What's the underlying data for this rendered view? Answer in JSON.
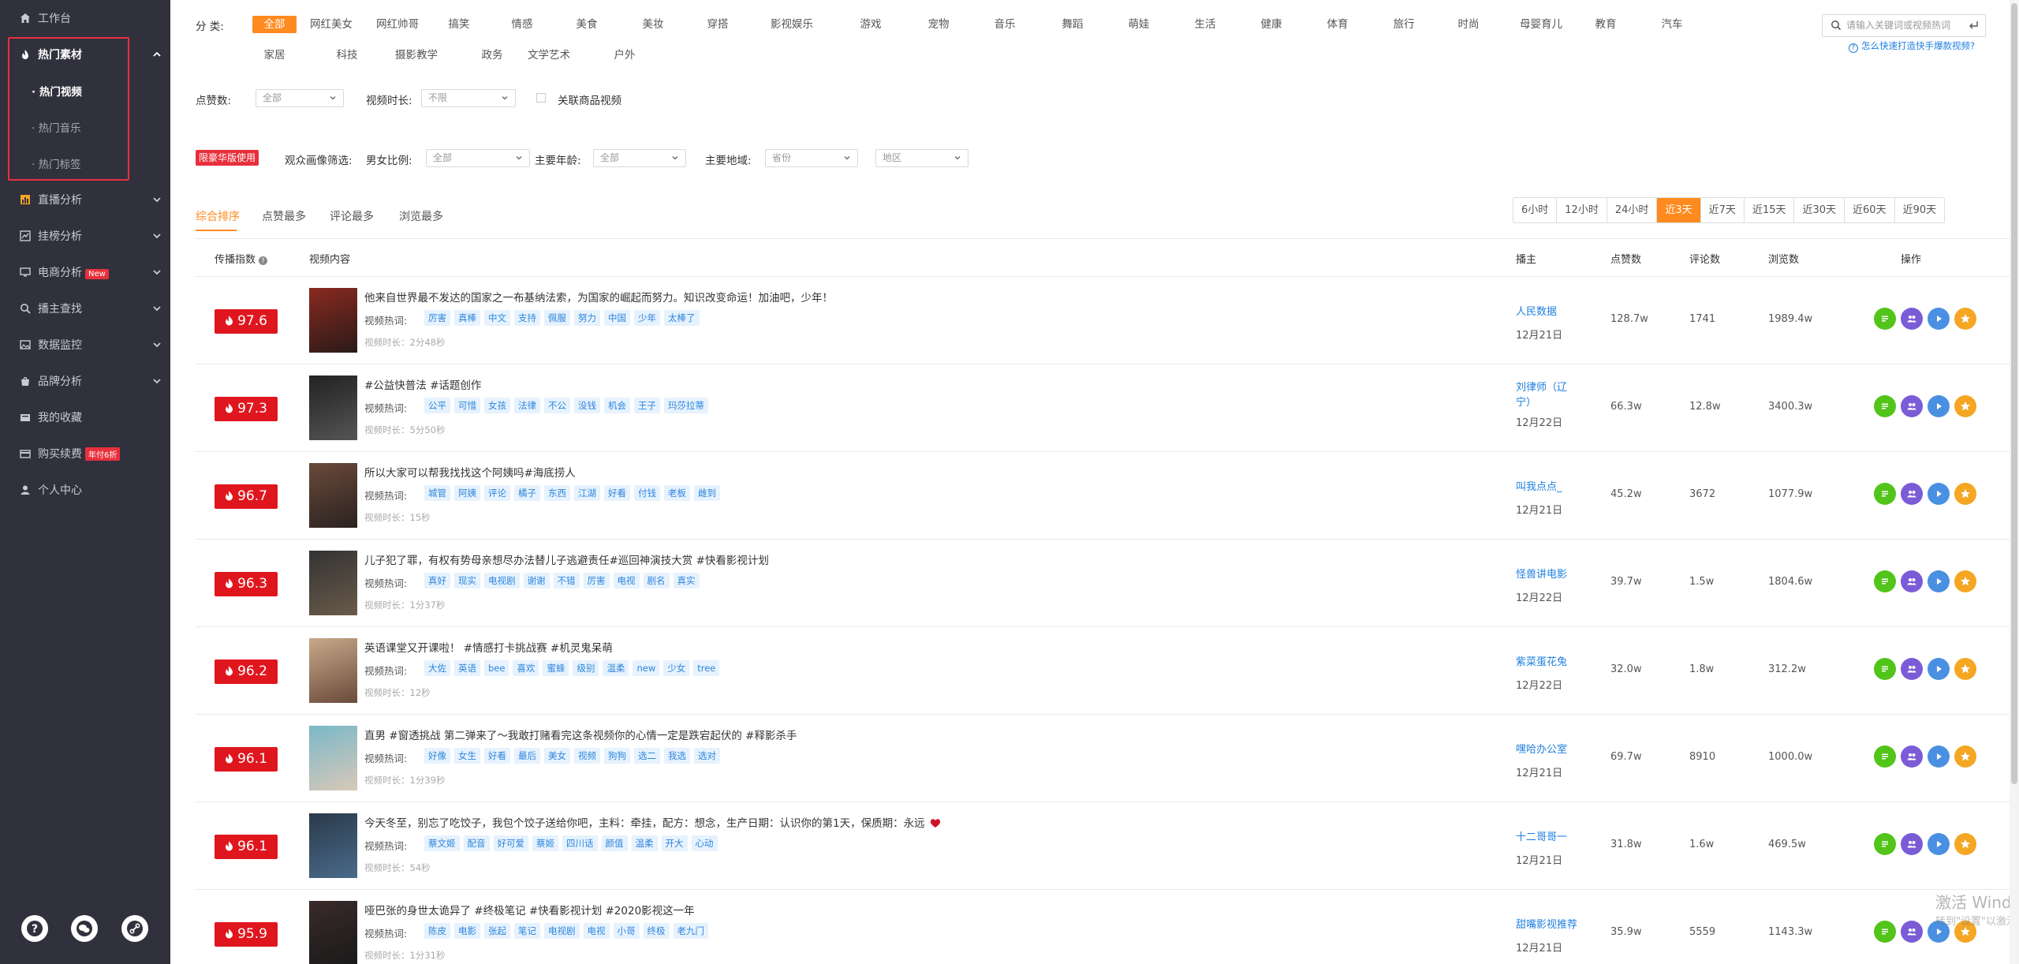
{
  "colors": {
    "accent": "#ff8a1f",
    "score_red": "#e0161e",
    "link_blue": "#1e7fe0",
    "sidebar_bg": "#30313d",
    "op_green": "#52c41a",
    "op_purple": "#7b5cd6",
    "op_blue": "#4a90e2",
    "op_orange": "#f5a623"
  },
  "sidebar": {
    "workbench": "工作台",
    "hot_material": "热门素材",
    "sub": [
      "· 热门视频",
      "· 热门音乐",
      "· 热门标签"
    ],
    "items": [
      "直播分析",
      "挂榜分析",
      "电商分析",
      "播主查找",
      "数据监控",
      "品牌分析",
      "我的收藏",
      "购买续费",
      "个人中心"
    ],
    "badge_new": "New",
    "badge_discount": "年付6折"
  },
  "filters": {
    "category_label": "分  类:",
    "categories_row1": [
      "全部",
      "网红美女",
      "网红帅哥",
      "搞笑",
      "情感",
      "美食",
      "美妆",
      "穿搭",
      "影视娱乐",
      "游戏",
      "宠物",
      "音乐",
      "舞蹈",
      "萌娃",
      "生活",
      "健康",
      "体育",
      "旅行",
      "时尚",
      "母婴育儿",
      "教育",
      "汽车"
    ],
    "categories_row2": [
      "家居",
      "科技",
      "摄影教学",
      "政务",
      "文学艺术",
      "户外"
    ],
    "likes_label": "点赞数:",
    "likes_value": "全部",
    "duration_label": "视频时长:",
    "duration_value": "不限",
    "goods_label": "关联商品视频",
    "premium_tag": "限豪华版使用",
    "audience_label": "观众画像筛选:",
    "gender_label": "男女比例:",
    "gender_value": "全部",
    "age_label": "主要年龄:",
    "age_value": "全部",
    "region_label": "主要地域:",
    "province_value": "省份",
    "city_value": "地区",
    "search_placeholder": "请输入关键词或视频热词",
    "help_link": "怎么快速打造快手爆款视频?"
  },
  "sort_tabs": [
    "综合排序",
    "点赞最多",
    "评论最多",
    "浏览最多"
  ],
  "time_tabs": [
    "6小时",
    "12小时",
    "24小时",
    "近3天",
    "近7天",
    "近15天",
    "近30天",
    "近60天",
    "近90天"
  ],
  "table": {
    "headers": {
      "index": "传播指数",
      "content": "视频内容",
      "author": "播主",
      "likes": "点赞数",
      "comments": "评论数",
      "views": "浏览数",
      "ops": "操作"
    },
    "kw_label": "视频热词:",
    "rows": [
      {
        "score": "97.6",
        "title": "他来自世界最不发达的国家之一布基纳法索，为国家的崛起而努力。知识改变命运！加油吧，少年！",
        "kw": [
          "厉害",
          "真棒",
          "中文",
          "支持",
          "佩服",
          "努力",
          "中国",
          "少年",
          "太棒了"
        ],
        "dur": "视频时长：2分48秒",
        "author": "人民数据",
        "date": "12月21日",
        "likes": "128.7w",
        "comments": "1741",
        "views": "1989.4w"
      },
      {
        "score": "97.3",
        "title": "#公益快普法 #话题创作",
        "kw": [
          "公平",
          "可惜",
          "女孩",
          "法律",
          "不公",
          "没钱",
          "机会",
          "王子",
          "玛莎拉蒂"
        ],
        "dur": "视频时长：5分50秒",
        "author": "刘律师（辽宁）",
        "date": "12月22日",
        "likes": "66.3w",
        "comments": "12.8w",
        "views": "3400.3w"
      },
      {
        "score": "96.7",
        "title": "所以大家可以帮我找找这个阿姨吗#海底捞人",
        "kw": [
          "城管",
          "阿姨",
          "评论",
          "橘子",
          "东西",
          "江湖",
          "好看",
          "付钱",
          "老板",
          "雌到"
        ],
        "dur": "视频时长：15秒",
        "author": "叫我点点_",
        "date": "12月21日",
        "likes": "45.2w",
        "comments": "3672",
        "views": "1077.9w"
      },
      {
        "score": "96.3",
        "title": "儿子犯了罪，有权有势母亲想尽办法替儿子逃避责任#巡回神演技大赏 #快看影视计划",
        "kw": [
          "真好",
          "现实",
          "电视剧",
          "谢谢",
          "不错",
          "厉害",
          "电视",
          "剧名",
          "真实"
        ],
        "dur": "视频时长：1分37秒",
        "author": "怪兽讲电影",
        "date": "12月22日",
        "likes": "39.7w",
        "comments": "1.5w",
        "views": "1804.6w"
      },
      {
        "score": "96.2",
        "title": "英语课堂又开课啦！ #情感打卡挑战赛 #机灵鬼呆萌",
        "kw": [
          "大佐",
          "英语",
          "bee",
          "喜欢",
          "蜜蜂",
          "级别",
          "温柔",
          "new",
          "少女",
          "tree"
        ],
        "dur": "视频时长：12秒",
        "author": "紫菜蛋花兔",
        "date": "12月22日",
        "likes": "32.0w",
        "comments": "1.8w",
        "views": "312.2w"
      },
      {
        "score": "96.1",
        "title": "直男 #窗透挑战 第二弹来了～我敢打赌看完这条视频你的心情一定是跌宕起伏的 #释影杀手",
        "kw": [
          "好像",
          "女生",
          "好看",
          "最后",
          "美女",
          "视频",
          "狗狗",
          "选二",
          "我选",
          "选对"
        ],
        "dur": "视频时长：1分39秒",
        "author": "嘿哈办公室",
        "date": "12月21日",
        "likes": "69.7w",
        "comments": "8910",
        "views": "1000.0w"
      },
      {
        "score": "96.1",
        "title": "今天冬至，别忘了吃饺子，我包个饺子送给你吧，主料：牵挂，配方：想念，生产日期：认识你的第1天，保质期：永远",
        "kw": [
          "蔡文姬",
          "配音",
          "好可爱",
          "蔡姬",
          "四川话",
          "颜值",
          "温柔",
          "开大",
          "心动"
        ],
        "dur": "视频时长：54秒",
        "author": "十二哥哥一",
        "date": "12月21日",
        "likes": "31.8w",
        "comments": "1.6w",
        "views": "469.5w"
      },
      {
        "score": "95.9",
        "title": "哑巴张的身世太诡异了 #终极笔记 #快看影视计划 #2020影视这一年",
        "kw": [
          "陈皮",
          "电影",
          "张起",
          "笔记",
          "电视剧",
          "电视",
          "小哥",
          "终极",
          "老九门"
        ],
        "dur": "视频时长：1分31秒",
        "author": "甜嘴影视推荐",
        "date": "12月21日",
        "likes": "35.9w",
        "comments": "5559",
        "views": "1143.3w"
      }
    ]
  },
  "watermark": {
    "line1": "激活 Windows",
    "line2": "转到\"设置\"以激活 Windows。"
  }
}
